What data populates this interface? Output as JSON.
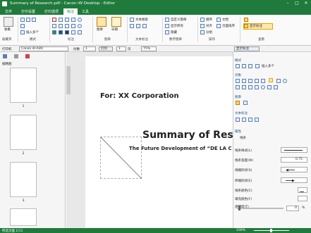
{
  "window": {
    "title": "Summary of Research.pdf - Canon iW Desktop - Editor"
  },
  "menus": [
    "文件",
    "打印设置",
    "打印选项",
    "标注",
    "工具"
  ],
  "ribbon": {
    "groups": [
      "收藏夹",
      "模式",
      "标注",
      "图章",
      "文本标注",
      "数字图章",
      "操作",
      "查看"
    ],
    "items": {
      "gather": "收集",
      "insert": "插入多个",
      "text_search": "文本搜索",
      "custom_stamp": "自定义图章",
      "show_all": "显示所有",
      "auto_hide": "隐藏",
      "arrange": "顺序",
      "align": "对齐",
      "group": "分组",
      "file": "文档",
      "page_order": "页面排序",
      "show": "显示标注",
      "stamp": "图章",
      "date": "日期"
    }
  },
  "printer": {
    "label": "打印机",
    "value": "Canon iR-ADV",
    "copies_label": "份数",
    "copies": "1",
    "print_btn": "打印",
    "page_label": "页",
    "page": "1",
    "zoom": "75%",
    "annot_btn": "显示标注"
  },
  "sidebar": {
    "title": "缩略图",
    "pages": [
      "1",
      "2",
      "3"
    ]
  },
  "document": {
    "company": "For: XX Corporation",
    "title": "Summary of Rese",
    "subtitle": "The Future Development of “DE LA C"
  },
  "panel": {
    "mode_title": "模式",
    "insert_multi": "插入多个",
    "objects_title": "对象",
    "stamp_title": "图章",
    "text_title": "文本标注",
    "props_title": "属性",
    "props_tab": "线条",
    "rows": [
      "线条样式(L)",
      "线条宽度(W)",
      "线端形状(S)",
      "终端形状(E)",
      "线条颜色(C)",
      "填充颜色(F)",
      "透明度(T)"
    ],
    "width_value": "0.75",
    "opacity_value": "0",
    "opacity_unit": "%"
  },
  "status": {
    "page_info": "所选页面 1/11",
    "zoom": "100%"
  },
  "colors": {
    "accent": "#1f7a3c",
    "panel_header": "#1f4f86"
  }
}
